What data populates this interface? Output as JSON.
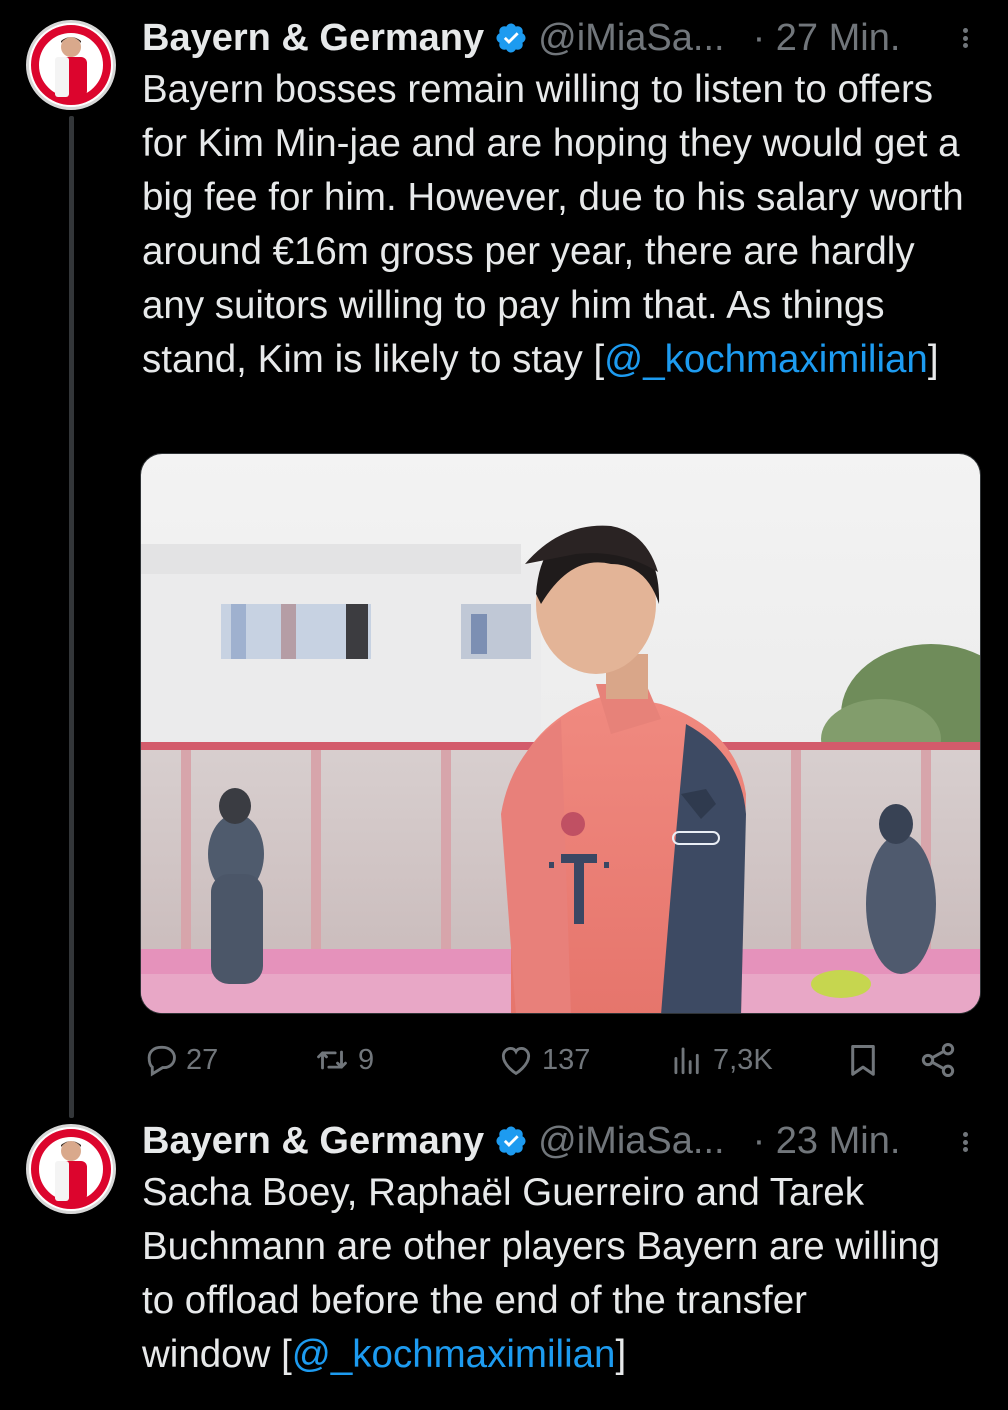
{
  "tweets": [
    {
      "author_name": "Bayern & Germany",
      "handle": "@iMiaSa...",
      "time": "· 27 Min.",
      "text_before_mention": "Bayern bosses remain willing to listen to offers for Kim Min-jae and are hoping they would get a big fee for him. However, due to his salary worth around €16m gross per year, there are hardly any suitors willing to pay him that. As things stand, Kim is likely to stay [",
      "mention": "@_kochmaximilian",
      "text_after_mention": "]",
      "media": {
        "type": "photo",
        "description": "Player in red training top"
      },
      "actions": {
        "replies": "27",
        "reposts": "9",
        "likes": "137",
        "views": "7,3K"
      }
    },
    {
      "author_name": "Bayern & Germany",
      "handle": "@iMiaSa...",
      "time": "· 23 Min.",
      "text_before_mention": "Sacha Boey, Raphaël Guerreiro and Tarek Buchmann are other players Bayern are willing to offload before the end of the transfer window [",
      "mention": "@_kochmaximilian",
      "text_after_mention": "]"
    }
  ],
  "colors": {
    "background": "#000000",
    "text": "#e7e9ea",
    "secondary": "#71767b",
    "accent": "#1d9bf0"
  },
  "icons": {
    "verified": "verified-badge-icon",
    "reply": "reply-icon",
    "repost": "repost-icon",
    "like": "heart-icon",
    "views": "views-icon",
    "bookmark": "bookmark-icon",
    "share": "share-icon",
    "more": "more-icon"
  }
}
